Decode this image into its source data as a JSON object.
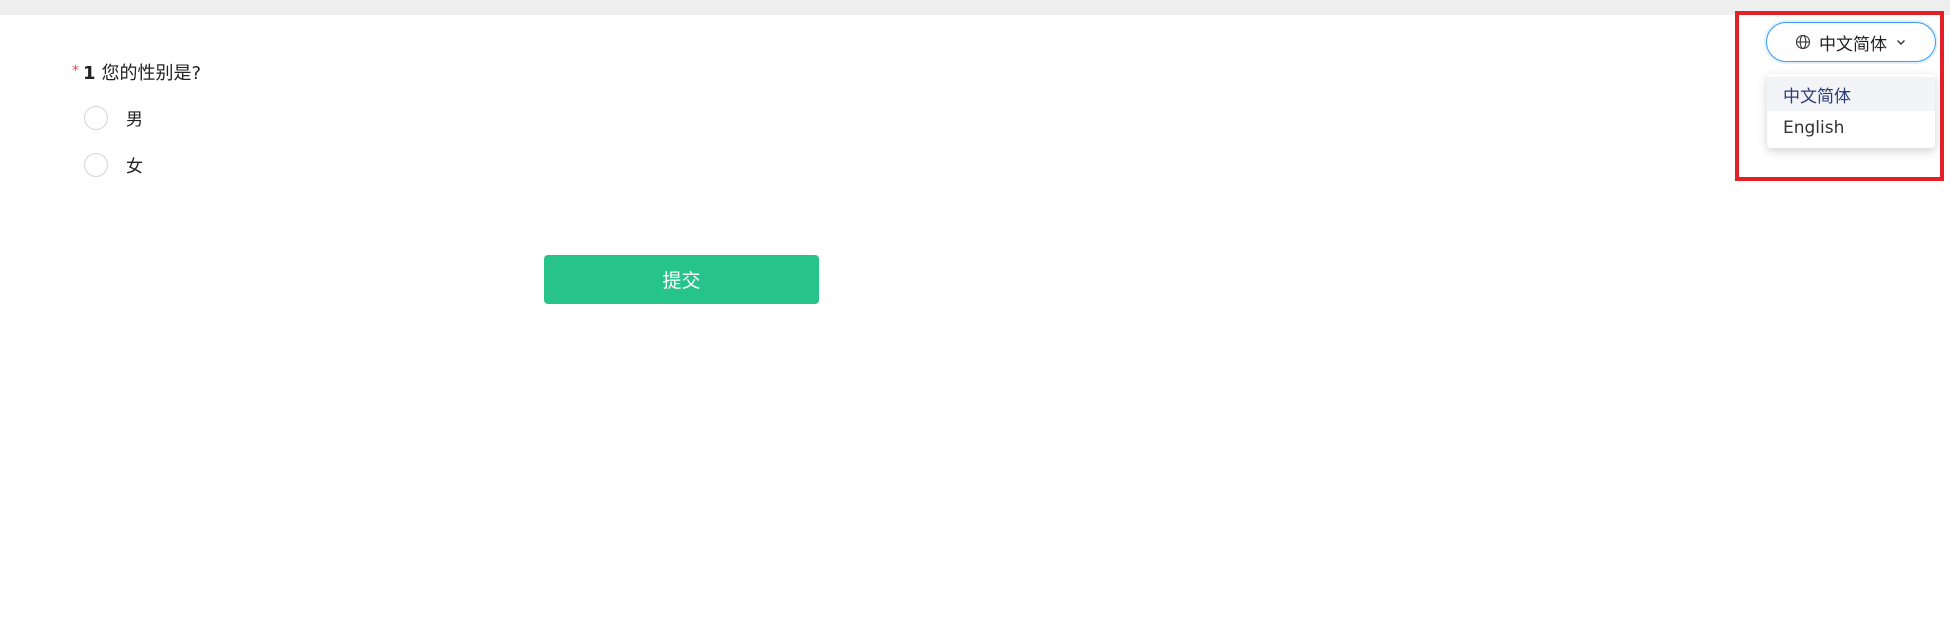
{
  "question": {
    "required_mark": "*",
    "number": "1",
    "title": "您的性别是?",
    "options": [
      {
        "label": "男"
      },
      {
        "label": "女"
      }
    ]
  },
  "submit_label": "提交",
  "language": {
    "current": "中文简体",
    "options": [
      {
        "label": "中文简体",
        "selected": true
      },
      {
        "label": "English",
        "selected": false
      }
    ]
  },
  "colors": {
    "accent": "#26c48a",
    "required": "#f04848",
    "highlight": "#e32028",
    "focus_border": "#3a9bf0"
  }
}
